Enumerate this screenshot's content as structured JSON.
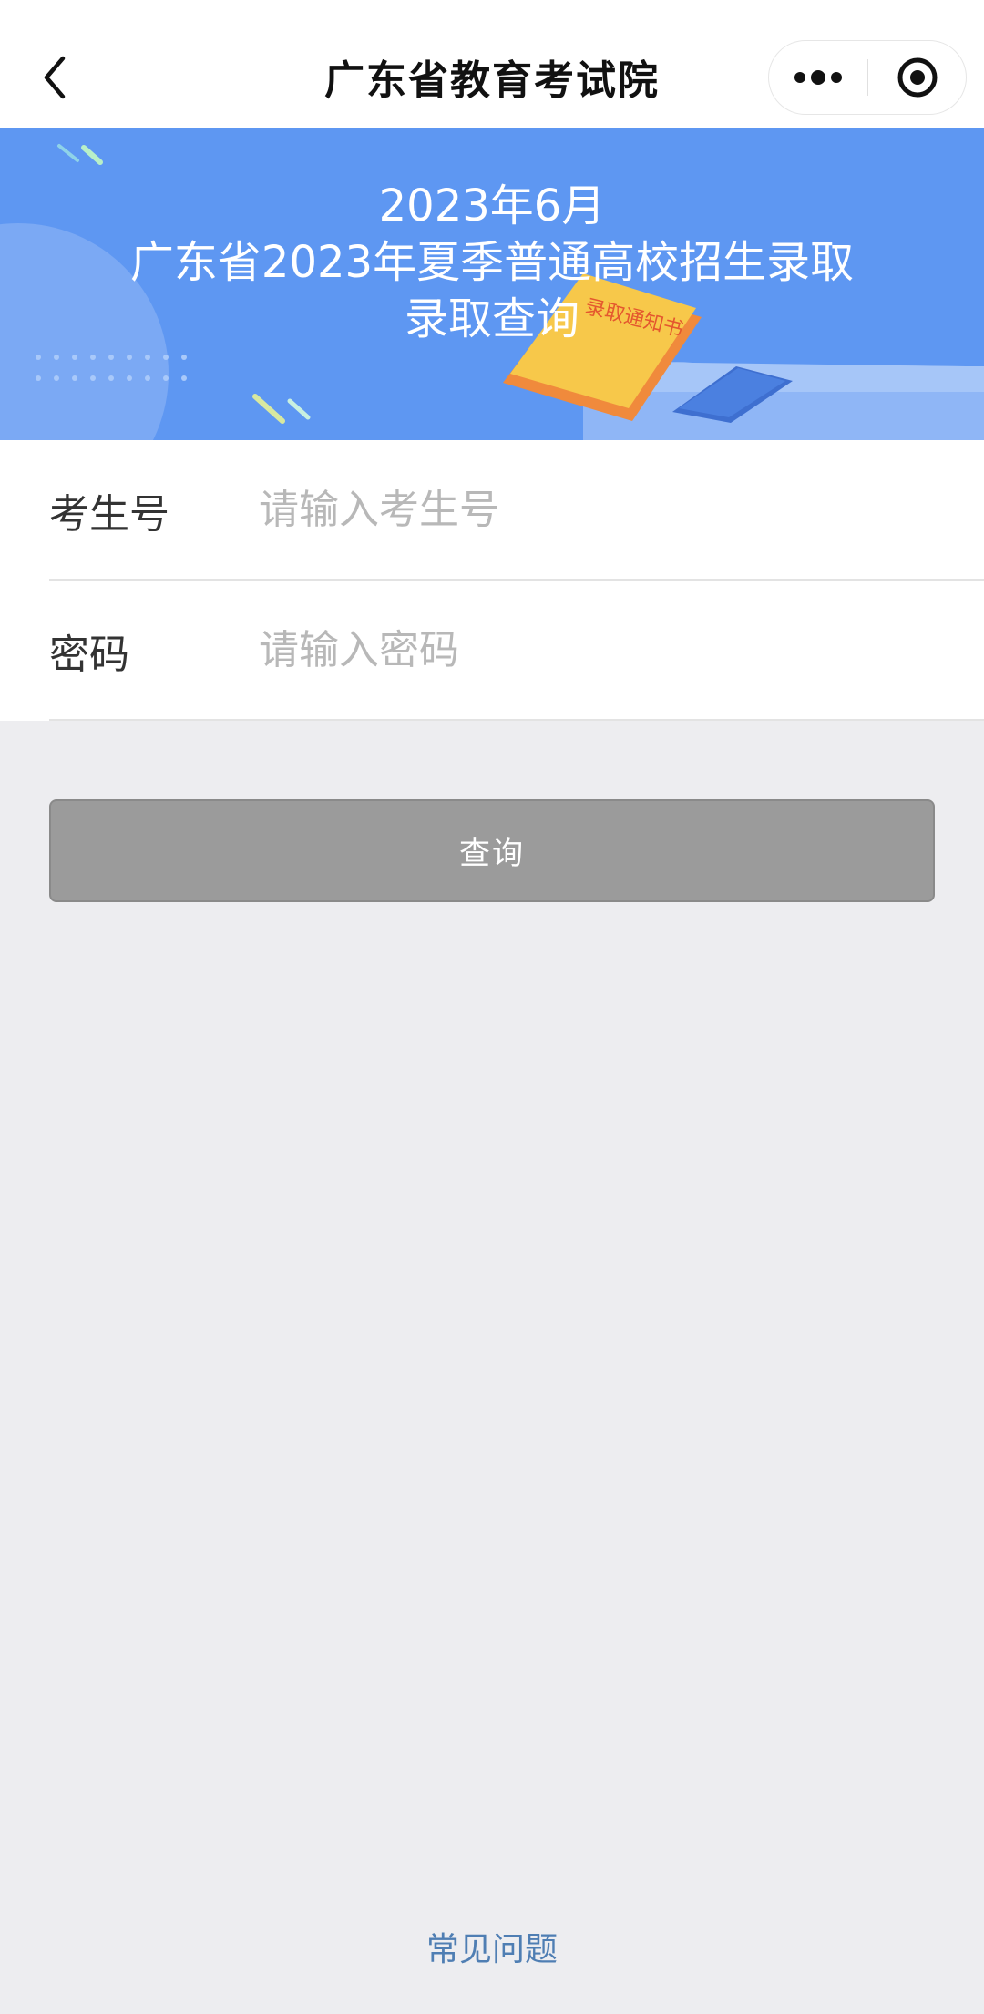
{
  "header": {
    "title": "广东省教育考试院"
  },
  "banner": {
    "line1": "2023年6月",
    "line2": "广东省2023年夏季普通高校招生录取",
    "line3": "录取查询",
    "book_text": "录取通知书"
  },
  "form": {
    "exam_no_label": "考生号",
    "exam_no_placeholder": "请输入考生号",
    "password_label": "密码",
    "password_placeholder": "请输入密码"
  },
  "actions": {
    "query_label": "查询",
    "faq_label": "常见问题"
  },
  "colors": {
    "banner": "#5e97f2",
    "button_disabled": "#9b9b9b",
    "link": "#4f7eb3",
    "background": "#ededf0"
  }
}
